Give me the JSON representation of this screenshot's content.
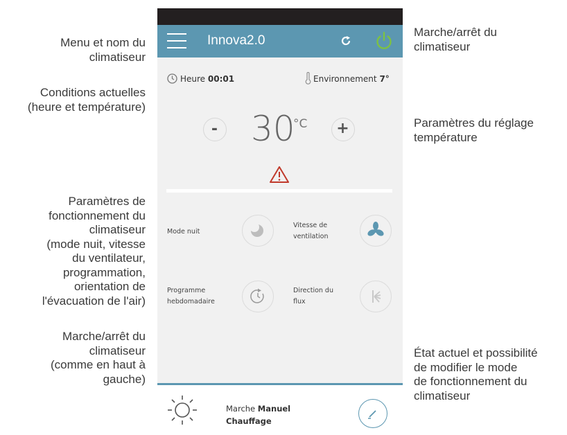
{
  "annotations": {
    "menu_name": "Menu et nom du\nclimatiseur",
    "power_top": "Marche/arrêt du\nclimatiseur",
    "current_conditions": "Conditions actuelles\n(heure et température)",
    "temp_settings": "Paramètres du réglage\ntempérature",
    "operation_params": "Paramètres de\nfonctionnement du\nclimatiseur\n(mode nuit, vitesse\ndu ventilateur,\nprogrammation,\norientation de\nl'évacuation de l'air)",
    "power_bottom": "Marche/arrêt du\nclimatiseur\n(comme en haut à\ngauche)",
    "current_state": "État actuel et possibilité\nde modifier le mode\nde fonctionnement du\nclimatiseur"
  },
  "app": {
    "title": "Innova2.0",
    "accent_color": "#5c97b1",
    "power_color": "#7dc242",
    "warning_color": "#c0392b"
  },
  "conditions": {
    "time_label": "Heure",
    "time_value": "00:01",
    "env_label": "Environnement",
    "env_value": "7°"
  },
  "temperature": {
    "value": "30",
    "unit": "°C",
    "minus": "-",
    "plus": "+"
  },
  "functions": {
    "night_mode": "Mode nuit",
    "fan_speed": "Vitesse de\nventilation",
    "weekly_program": "Programme\nhebdomadaire",
    "flow_direction": "Direction du\nflux"
  },
  "icons": [
    "menu-icon",
    "refresh-icon",
    "power-icon",
    "clock-icon",
    "thermometer-icon",
    "warning-icon",
    "moon-icon",
    "fan-icon",
    "timer-icon",
    "flow-direction-icon",
    "sun-icon",
    "pencil-icon"
  ],
  "mode": {
    "prefix": "Marche",
    "type": "Manuel",
    "name": "Chauffage"
  }
}
